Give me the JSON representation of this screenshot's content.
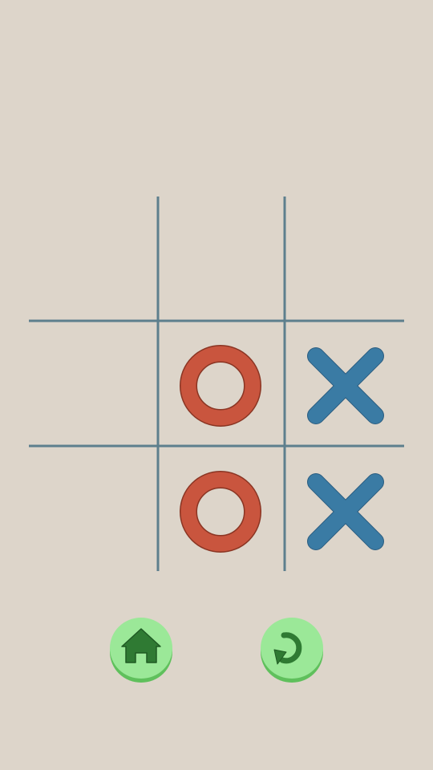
{
  "game": {
    "board": [
      [
        "",
        "",
        ""
      ],
      [
        "",
        "O",
        "X"
      ],
      [
        "",
        "O",
        "X"
      ]
    ],
    "colors": {
      "background": "#ddd5ca",
      "grid_line": "#5d7f8d",
      "o_mark": "#c9553e",
      "o_outline": "#8a3523",
      "x_mark": "#3a7ba4",
      "x_outline": "#2b5d80"
    }
  },
  "controls": {
    "home_icon": "home-icon",
    "restart_icon": "restart-icon",
    "button_color": "#9be898",
    "button_shadow": "#5fc05c",
    "icon_color": "#2f7a33"
  }
}
